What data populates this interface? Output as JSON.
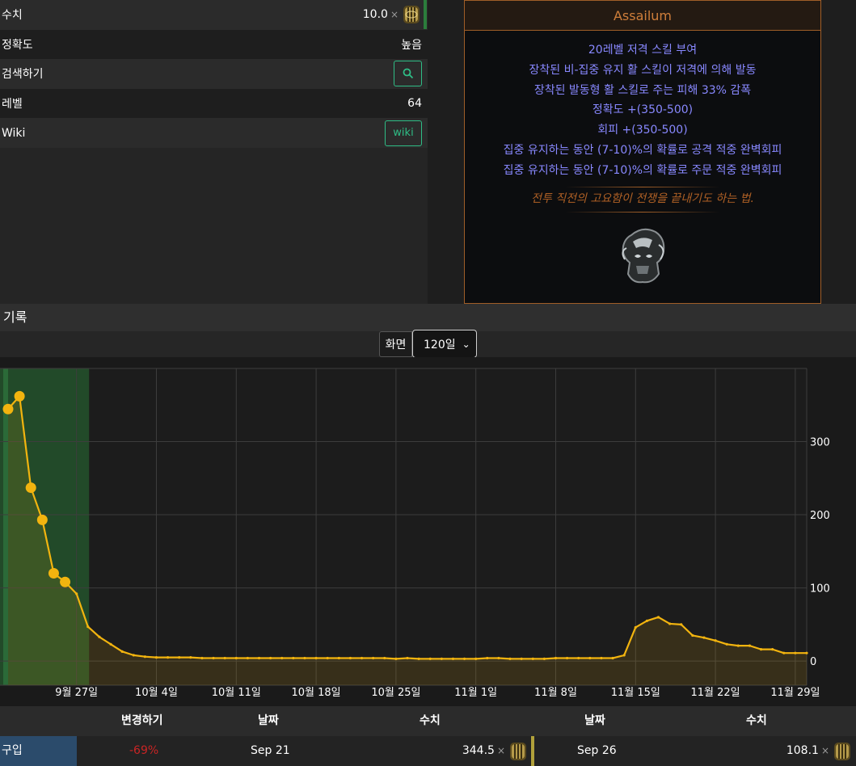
{
  "stats": {
    "rows": [
      {
        "label": "수치",
        "value": "10.0",
        "mult": "×"
      },
      {
        "label": "정확도",
        "value": "높음"
      },
      {
        "label": "검색하기"
      },
      {
        "label": "레벨",
        "value": "64"
      },
      {
        "label": "Wiki",
        "button": "wiki"
      }
    ]
  },
  "item": {
    "name": "Assailum",
    "mods": [
      "20레벨 저격 스킬 부여",
      "장착된 비-집중 유지 활 스킬이 저격에 의해 발동",
      "장착된 발동형 활 스킬로 주는 피해 33% 감폭",
      "정확도 +(350-500)",
      "회피 +(350-500)",
      "집중 유지하는 동안 (7-10)%의 확률로 공격 적중 완벽회피",
      "집중 유지하는 동안 (7-10)%의 확률로 주문 적중 완벽회피"
    ],
    "flavour": "전투 직전의 고요함이 전쟁을 끝내기도 하는 법."
  },
  "history": {
    "title": "기록",
    "view_label": "화면",
    "view_selected": "120일"
  },
  "colors": {
    "line": "#f2b40f",
    "highlight": "#23502b",
    "accent": "#2fbd86"
  },
  "chart_data": {
    "type": "line",
    "x_tick_labels": [
      "9월 27일",
      "10월 4일",
      "10월 11일",
      "10월 18일",
      "10월 25일",
      "11월 1일",
      "11월 8일",
      "11월 15일",
      "11월 22일",
      "11월 29일"
    ],
    "y_ticks": [
      0,
      100,
      200,
      300
    ],
    "ylim": [
      -33,
      400
    ],
    "highlight_days": 7,
    "dates": [
      "Sep 21",
      "Sep 22",
      "Sep 23",
      "Sep 24",
      "Sep 25",
      "Sep 26",
      "Sep 27",
      "Sep 28",
      "Sep 29",
      "Sep 30",
      "Oct 1",
      "Oct 2",
      "Oct 3",
      "Oct 4",
      "Oct 5",
      "Oct 6",
      "Oct 7",
      "Oct 8",
      "Oct 9",
      "Oct 10",
      "Oct 11",
      "Oct 12",
      "Oct 13",
      "Oct 14",
      "Oct 15",
      "Oct 16",
      "Oct 17",
      "Oct 18",
      "Oct 19",
      "Oct 20",
      "Oct 21",
      "Oct 22",
      "Oct 23",
      "Oct 24",
      "Oct 25",
      "Oct 26",
      "Oct 27",
      "Oct 28",
      "Oct 29",
      "Oct 30",
      "Oct 31",
      "Nov 1",
      "Nov 2",
      "Nov 3",
      "Nov 4",
      "Nov 5",
      "Nov 6",
      "Nov 7",
      "Nov 8",
      "Nov 9",
      "Nov 10",
      "Nov 11",
      "Nov 12",
      "Nov 13",
      "Nov 14",
      "Nov 15",
      "Nov 16",
      "Nov 17",
      "Nov 18",
      "Nov 19",
      "Nov 20",
      "Nov 21",
      "Nov 22",
      "Nov 23",
      "Nov 24",
      "Nov 25",
      "Nov 26",
      "Nov 27",
      "Nov 28",
      "Nov 29",
      "Nov 30"
    ],
    "values": [
      344.5,
      362,
      237,
      193,
      120,
      108.1,
      92,
      47,
      33,
      23,
      13,
      8,
      6,
      5,
      5,
      5,
      5,
      4,
      4,
      4,
      4,
      4,
      4,
      4,
      4,
      4,
      4,
      4,
      4,
      4,
      4,
      4,
      4,
      4,
      3,
      4,
      3,
      3,
      3,
      3,
      3,
      3,
      4,
      4,
      3,
      3,
      3,
      3,
      4,
      4,
      4,
      4,
      4,
      4,
      8,
      46,
      55,
      60,
      51,
      50,
      35,
      32,
      28,
      23,
      21,
      21,
      16,
      16,
      11,
      11,
      11
    ]
  },
  "table": {
    "headers": {
      "change": "변경하기",
      "date1": "날짜",
      "value1": "수치",
      "date2": "날짜",
      "value2": "수치"
    },
    "row": {
      "type": "구입",
      "change": "-69%",
      "date1": "Sep 21",
      "value1": "344.5",
      "mult": "×",
      "date2": "Sep 26",
      "value2": "108.1"
    }
  }
}
